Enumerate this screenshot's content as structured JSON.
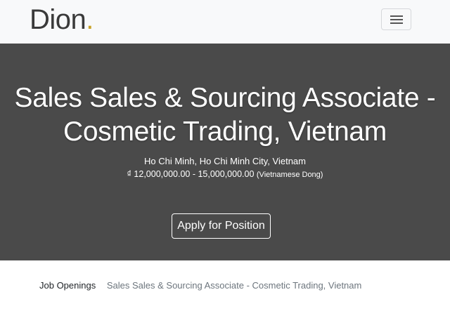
{
  "navbar": {
    "brand": "Dion",
    "brand_dot": ".",
    "menu_icon": "hamburger-menu-icon"
  },
  "hero": {
    "title": "Sales Sales & Sourcing Associate - Cosmetic Trading, Vietnam",
    "location": "Ho Chi Minh, Ho Chi Minh City, Vietnam",
    "salary_range": "₫ 12,000,000.00 - 15,000,000.00",
    "salary_currency": "(Vietnamese Dong)",
    "apply_label": "Apply for Position"
  },
  "breadcrumb": {
    "parent": "Job Openings",
    "current": "Sales Sales & Sourcing Associate - Cosmetic Trading, Vietnam"
  },
  "colors": {
    "navbar_bg": "#f8f9fa",
    "hero_bg": "#4a4a4a",
    "brand_accent": "#c9a227"
  }
}
